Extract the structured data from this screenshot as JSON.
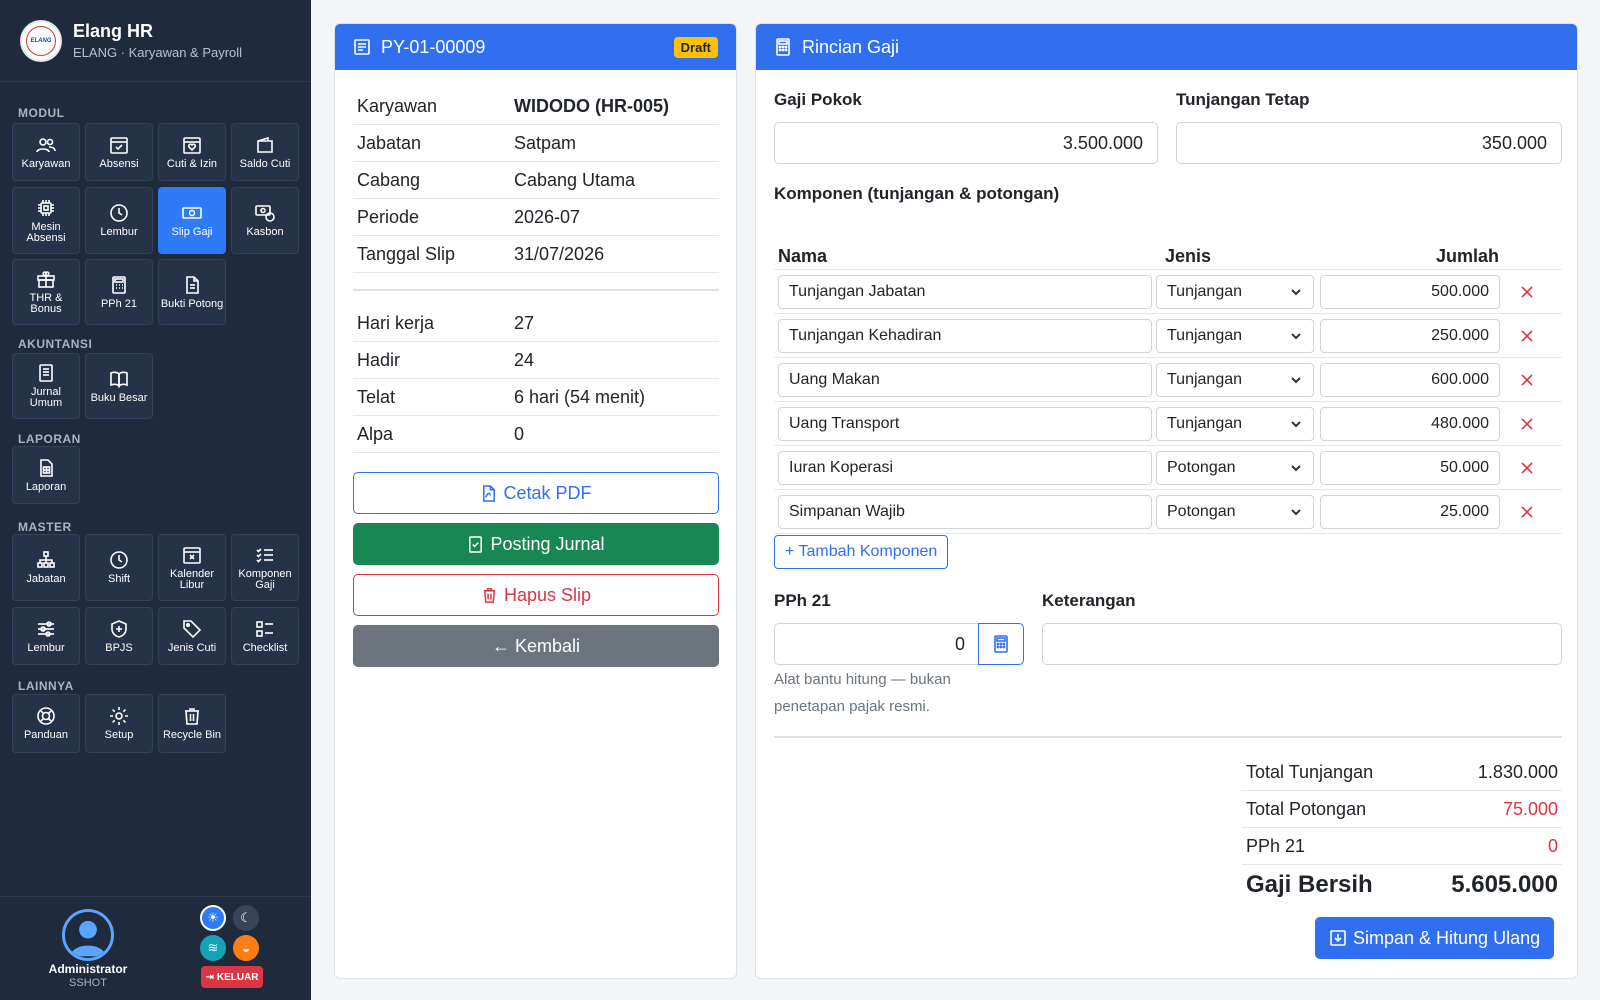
{
  "brand": {
    "title": "Elang HR",
    "subtitle": "ELANG · Karyawan & Payroll",
    "logo_text": "ELANG"
  },
  "sidebar": {
    "sections": [
      "MODUL",
      "AKUNTANSI",
      "LAPORAN",
      "MASTER",
      "LAINNYA"
    ],
    "modul": [
      {
        "label": "Karyawan",
        "icon": "users-icon"
      },
      {
        "label": "Absensi",
        "icon": "calendar-check-icon"
      },
      {
        "label": "Cuti & Izin",
        "icon": "calendar-heart-icon"
      },
      {
        "label": "Saldo Cuti",
        "icon": "wallet-icon"
      },
      {
        "label": "Mesin\nAbsensi",
        "icon": "cpu-icon"
      },
      {
        "label": "Lembur",
        "icon": "clock-icon"
      },
      {
        "label": "Slip Gaji",
        "icon": "cash-icon",
        "active": true
      },
      {
        "label": "Kasbon",
        "icon": "cash-coin-icon"
      },
      {
        "label": "THR &\nBonus",
        "icon": "gift-icon"
      },
      {
        "label": "PPh 21",
        "icon": "calculator-icon"
      },
      {
        "label": "Bukti Potong",
        "icon": "file-text-icon"
      }
    ],
    "akuntansi": [
      {
        "label": "Jurnal\nUmum",
        "icon": "journal-icon"
      },
      {
        "label": "Buku Besar",
        "icon": "book-icon"
      }
    ],
    "laporan": [
      {
        "label": "Laporan",
        "icon": "report-icon"
      }
    ],
    "master": [
      {
        "label": "Jabatan",
        "icon": "org-chart-icon"
      },
      {
        "label": "Shift",
        "icon": "clock-icon"
      },
      {
        "label": "Kalender\nLibur",
        "icon": "calendar-x-icon"
      },
      {
        "label": "Komponen\nGaji",
        "icon": "list-check-icon"
      },
      {
        "label": "Lembur",
        "icon": "sliders-icon"
      },
      {
        "label": "BPJS",
        "icon": "shield-icon"
      },
      {
        "label": "Jenis Cuti",
        "icon": "tags-icon"
      },
      {
        "label": "Checklist",
        "icon": "checklist-icon"
      }
    ],
    "lainnya": [
      {
        "label": "Panduan",
        "icon": "lifebuoy-icon"
      },
      {
        "label": "Setup",
        "icon": "gear-icon"
      },
      {
        "label": "Recycle Bin",
        "icon": "trash-icon"
      }
    ]
  },
  "user": {
    "name": "Administrator",
    "role": "SSHOT",
    "logout_label": "KELUAR"
  },
  "theme_colors": {
    "light": "#2f7bf5",
    "dark": "#3a4458",
    "blue": "#17a2b8",
    "orange": "#fd7e14"
  },
  "slip": {
    "code": "PY-01-00009",
    "status": "Draft",
    "info": [
      {
        "key": "Karyawan",
        "value": "WIDODO (HR-005)"
      },
      {
        "key": "Jabatan",
        "value": "Satpam"
      },
      {
        "key": "Cabang",
        "value": "Cabang Utama"
      },
      {
        "key": "Periode",
        "value": "2026-07"
      },
      {
        "key": "Tanggal Slip",
        "value": "31/07/2026"
      }
    ],
    "attendance": [
      {
        "key": "Hari kerja",
        "value": "27"
      },
      {
        "key": "Hadir",
        "value": "24"
      },
      {
        "key": "Telat",
        "value": "6 hari (54 menit)"
      },
      {
        "key": "Alpa",
        "value": "0"
      }
    ],
    "buttons": {
      "print": "Cetak PDF",
      "post": "Posting Jurnal",
      "delete": "Hapus Slip",
      "back": "← Kembali"
    }
  },
  "rincian": {
    "title": "Rincian Gaji",
    "gaji_pokok_label": "Gaji Pokok",
    "gaji_pokok": "3.500.000",
    "tunjangan_tetap_label": "Tunjangan Tetap",
    "tunjangan_tetap": "350.000",
    "components_title": "Komponen (tunjangan & potongan)",
    "columns": [
      "Nama",
      "Jenis",
      "Jumlah"
    ],
    "components": [
      {
        "name": "Tunjangan Jabatan",
        "type": "Tunjangan",
        "amount": "500.000"
      },
      {
        "name": "Tunjangan Kehadiran",
        "type": "Tunjangan",
        "amount": "250.000"
      },
      {
        "name": "Uang Makan",
        "type": "Tunjangan",
        "amount": "600.000"
      },
      {
        "name": "Uang Transport",
        "type": "Tunjangan",
        "amount": "480.000"
      },
      {
        "name": "Iuran Koperasi",
        "type": "Potongan",
        "amount": "50.000"
      },
      {
        "name": "Simpanan Wajib",
        "type": "Potongan",
        "amount": "25.000"
      }
    ],
    "add_component": "+ Tambah Komponen",
    "pph_label": "PPh 21",
    "pph_value": "0",
    "pph_hint": "Alat bantu hitung — bukan penetapan pajak resmi.",
    "keterangan_label": "Keterangan",
    "keterangan_value": "",
    "totals": [
      {
        "label": "Total Tunjangan",
        "value": "1.830.000"
      },
      {
        "label": "Total Potongan",
        "value": "75.000"
      },
      {
        "label": "PPh 21",
        "value": "0"
      }
    ],
    "net_label": "Gaji Bersih",
    "net_value": "5.605.000",
    "save_button": "Simpan & Hitung Ulang"
  }
}
